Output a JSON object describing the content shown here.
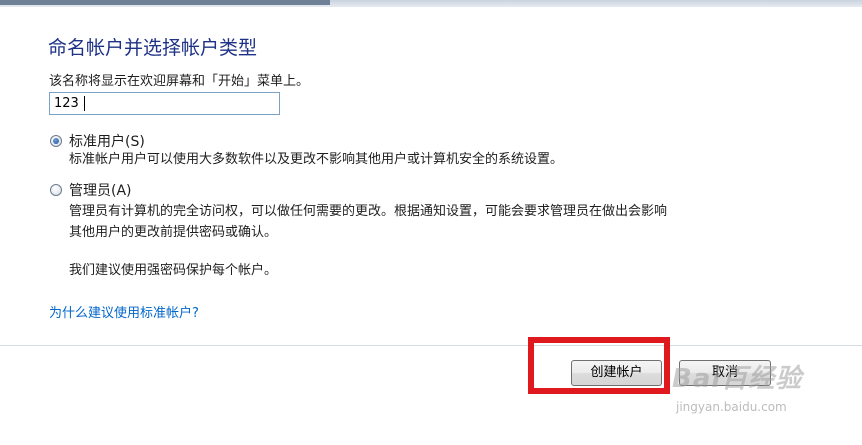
{
  "dialog": {
    "heading": "命名帐户并选择帐户类型",
    "description": "该名称将显示在欢迎屏幕和「开始」菜单上。",
    "name_input": {
      "value": "123",
      "placeholder": ""
    },
    "options": [
      {
        "label": "标准用户(S)",
        "checked": true,
        "description_lines": [
          "标准帐户用户可以使用大多数软件以及更改不影响其他用户或计算机安全的系统设置。"
        ]
      },
      {
        "label": "管理员(A)",
        "checked": false,
        "description_lines": [
          "管理员有计算机的完全访问权，可以做任何需要的更改。根据通知设置，可能会要求管理员在做出会影响",
          "其他用户的更改前提供密码或确认。"
        ]
      }
    ],
    "password_advice": "我们建议使用强密码保护每个帐户。",
    "help_link": "为什么建议使用标准帐户?",
    "buttons": {
      "create": "创建帐户",
      "cancel": "取消"
    }
  },
  "overlay": {
    "highlight_color": "#e0191e",
    "watermark_logo": "Bai百经验",
    "watermark_url": "jingyan.baidu.com"
  }
}
